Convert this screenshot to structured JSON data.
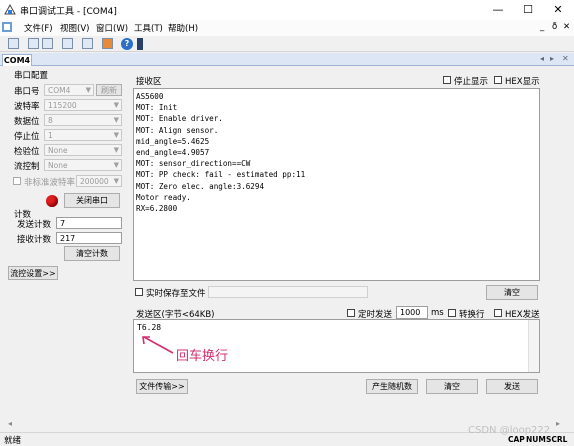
{
  "window": {
    "title": "串口调试工具 - [COM4]",
    "minimize": "—",
    "maximize": "☐",
    "close": "✕"
  },
  "menu": {
    "items": [
      "文件(F)",
      "视图(V)",
      "窗口(W)",
      "工具(T)",
      "帮助(H)"
    ],
    "right_controls": [
      "_",
      "ð",
      "✕"
    ]
  },
  "tab": {
    "label": "COM4",
    "right_controls": [
      "◂",
      "▸",
      "✕"
    ]
  },
  "port_config": {
    "group_title": "串口配置",
    "port_label": "串口号",
    "port_value": "COM4",
    "refresh": "刷新",
    "baud_label": "波特率",
    "baud_value": "115200",
    "databits_label": "数据位",
    "databits_value": "8",
    "stopbits_label": "停止位",
    "stopbits_value": "1",
    "parity_label": "检验位",
    "parity_value": "None",
    "flow_label": "流控制",
    "flow_value": "None",
    "nonstd_label": "非标准波特率",
    "nonstd_value": "200000",
    "close_port": "关闭串口",
    "status_color": "#e02020"
  },
  "counter": {
    "group_title": "计数",
    "send_label": "发送计数",
    "send_value": "7",
    "recv_label": "接收计数",
    "recv_value": "217",
    "clear": "清空计数"
  },
  "flow_settings": "流控设置>>",
  "receive": {
    "title": "接收区",
    "pause_label": "停止显示",
    "hex_label": "HEX显示",
    "lines": [
      "AS5600",
      "MOT: Init",
      "MOT: Enable driver.",
      "MOT: Align sensor.",
      "mid_angle=5.4625",
      "end_angle=4.9057",
      "MOT: sensor_direction==CW",
      "MOT: PP check: fail - estimated pp:11",
      "MOT: Zero elec. angle:3.6294",
      "Motor ready.",
      "RX=6.2800"
    ],
    "save_label": "实时保存至文件",
    "clear": "清空"
  },
  "send": {
    "title": "发送区(字节<64KB)",
    "timer_label": "定时发送",
    "interval": "1000",
    "unit": "ms",
    "newline_label": "转换行",
    "hex_label": "HEX发送",
    "content": "T6.28",
    "annotation": "回车换行",
    "annotation_color": "#d03070",
    "file_transfer": "文件传输>>",
    "random": "产生随机数",
    "clear": "清空",
    "send": "发送"
  },
  "status": {
    "left": "就绪",
    "watermark": "CSDN @loop222",
    "indicators": [
      "CAP",
      "NUM",
      "SCRL"
    ]
  }
}
